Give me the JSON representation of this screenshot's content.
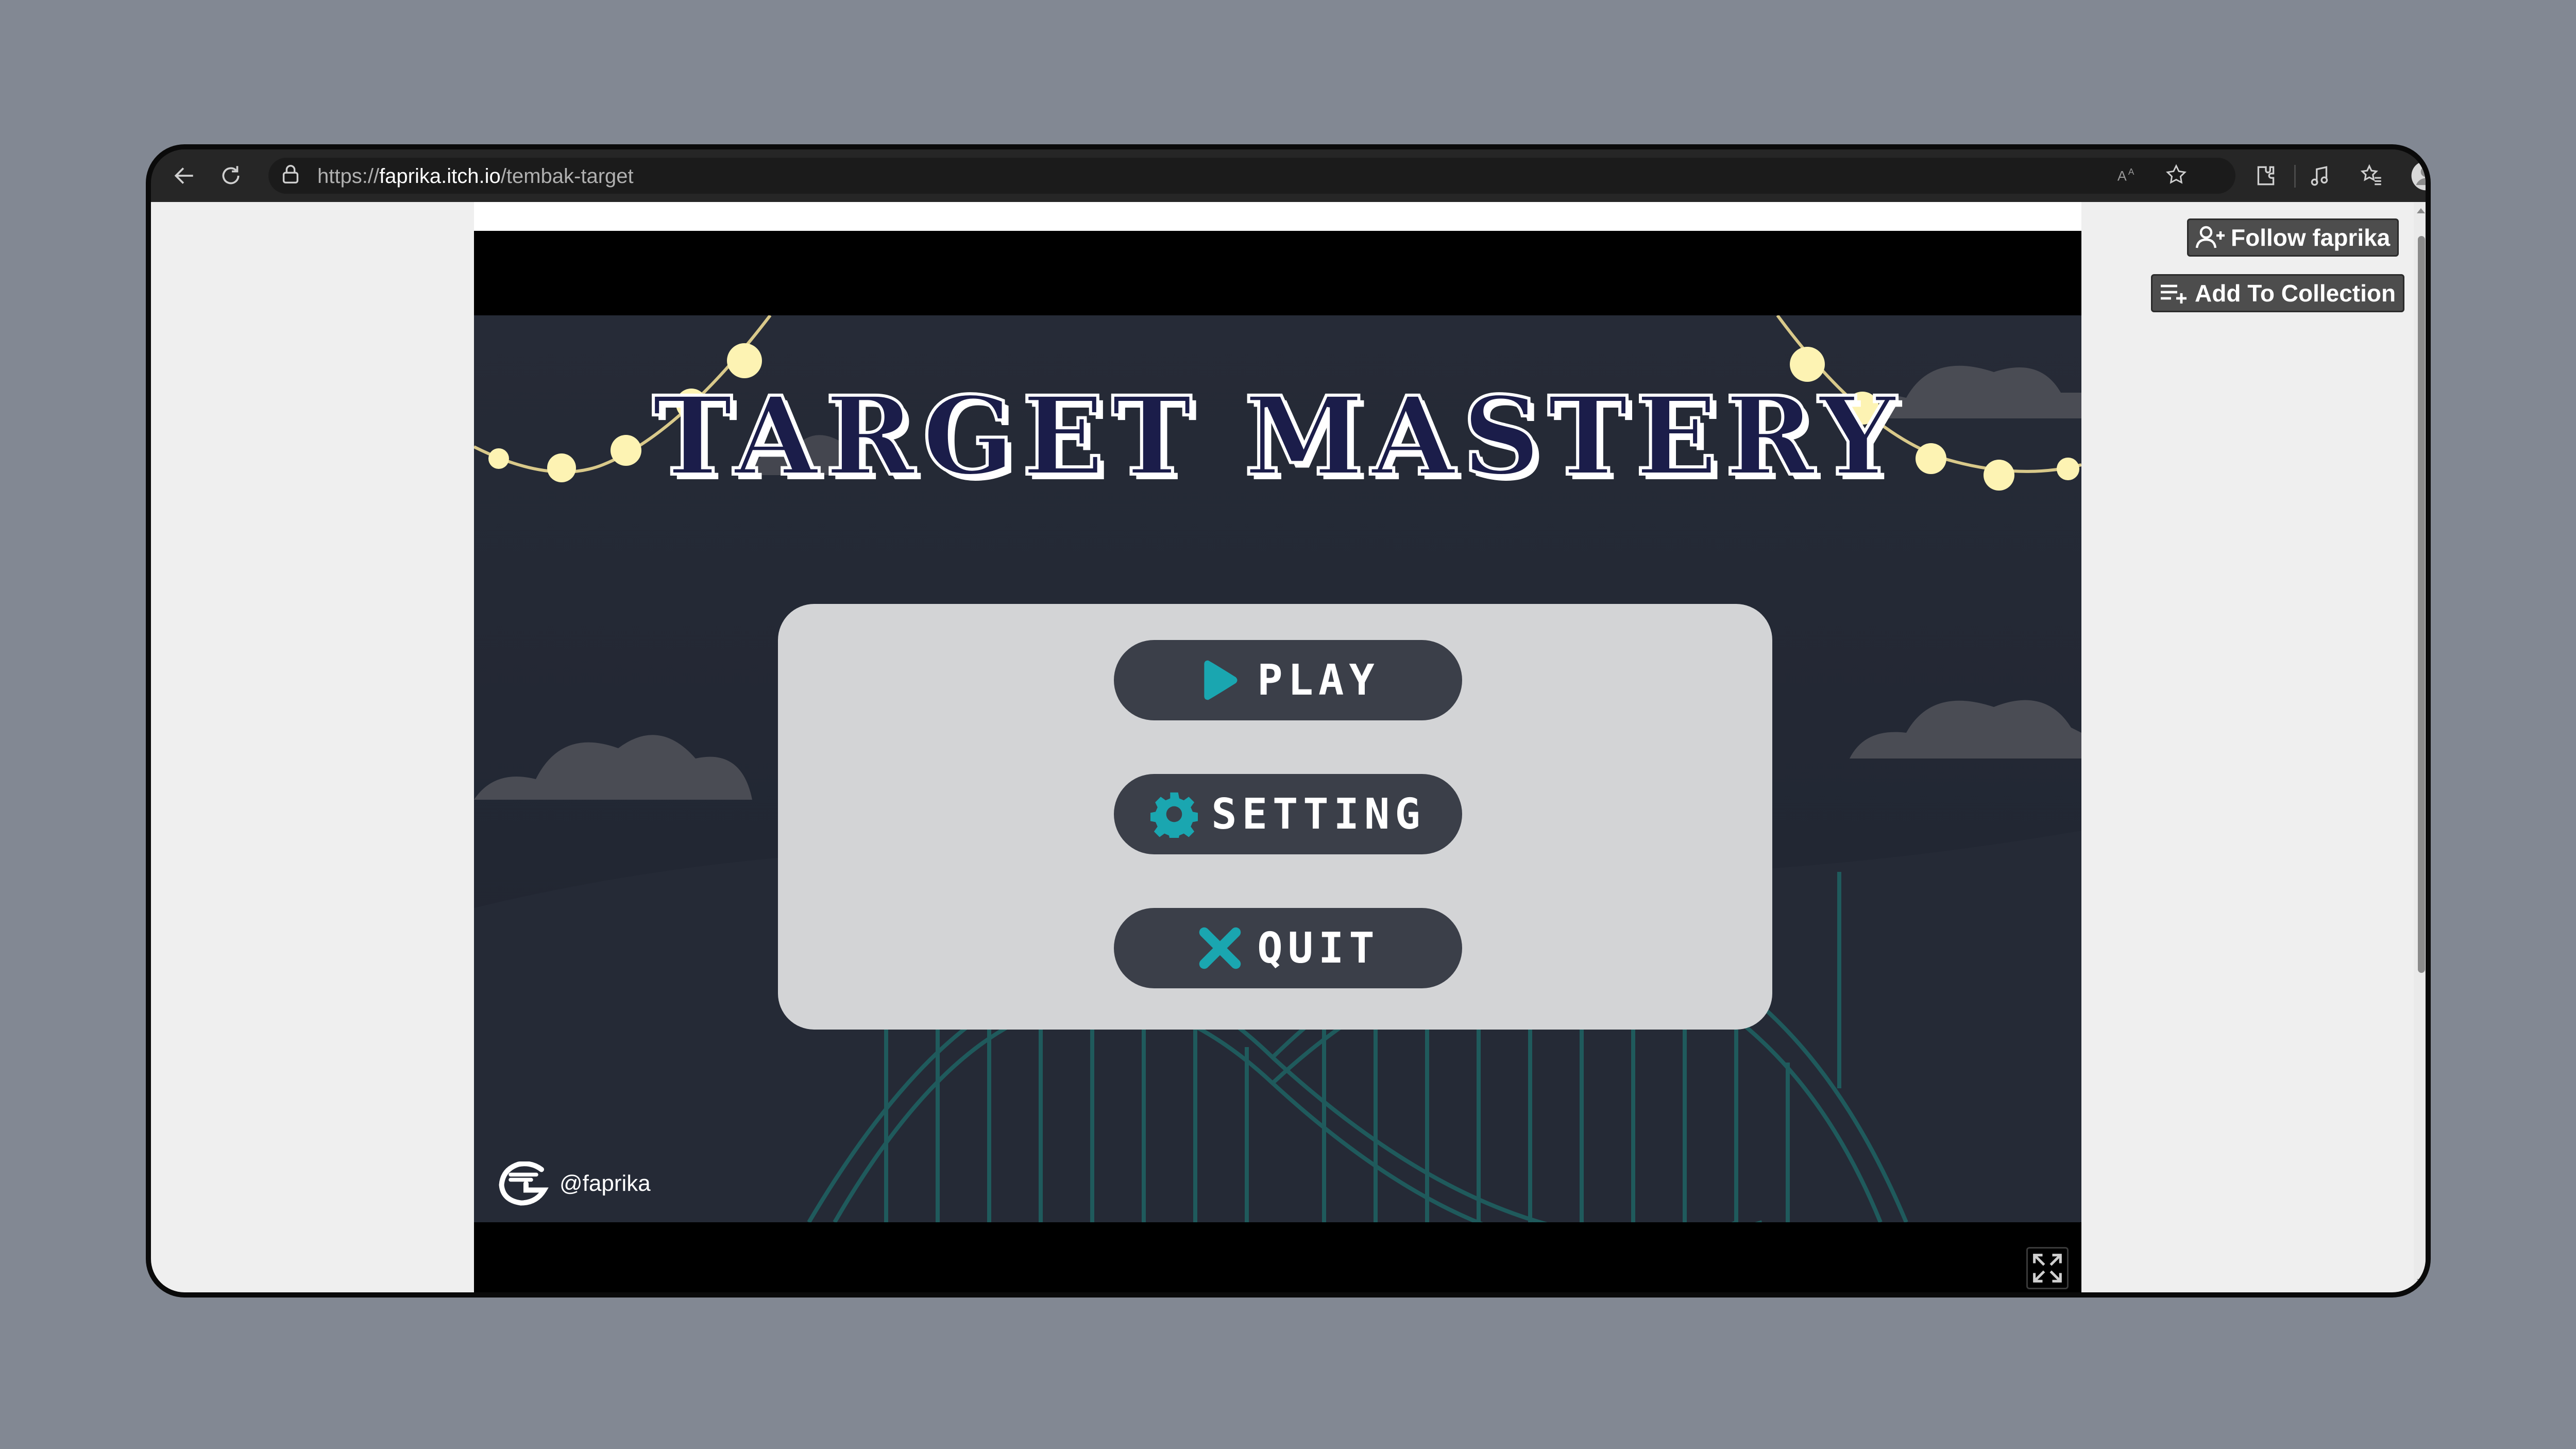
{
  "browser": {
    "url_scheme": "https://",
    "url_host": "faprika.itch.io",
    "url_path": "/tembak-target",
    "toolbar_icons": [
      "back-icon",
      "refresh-icon",
      "lock-icon",
      "read-aloud-icon",
      "favorite-star-icon",
      "extensions-icon",
      "media-icon",
      "favorites-list-icon",
      "profile-avatar-icon",
      "more-icon",
      "copilot-icon"
    ]
  },
  "game": {
    "title": "TARGET MASTERY",
    "menu": {
      "play_label": "PLAY",
      "setting_label": "SETTING",
      "quit_label": "QUIT"
    },
    "credit": "@faprika",
    "accent_color": "#1aa6b0"
  },
  "sidebar": {
    "follow_label": "Follow faprika",
    "collection_label": "Add To Collection"
  }
}
